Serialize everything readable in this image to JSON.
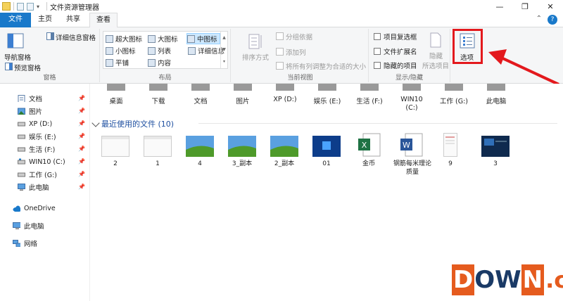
{
  "window": {
    "title": "文件资源管理器",
    "minimize": "—",
    "maximize": "❐",
    "close": "✕"
  },
  "tabs": {
    "file": "文件",
    "home": "主页",
    "share": "共享",
    "view": "查看"
  },
  "ribbon": {
    "pane": {
      "nav_pane": "导航窗格",
      "preview_pane": "预览窗格",
      "details_pane": "详细信息窗格",
      "label": "窗格"
    },
    "layout": {
      "xlarge": "超大图标",
      "large": "大图标",
      "medium": "中图标",
      "small": "小图标",
      "list": "列表",
      "details": "详细信息",
      "tiles": "平铺",
      "content": "内容",
      "label": "布局"
    },
    "current_view": {
      "sort": "排序方式",
      "group": "分组依据",
      "add_column": "添加列",
      "fit_columns": "将所有列调整为合适的大小",
      "label": "当前视图"
    },
    "show_hide": {
      "item_checkboxes": "项目复选框",
      "file_ext": "文件扩展名",
      "hidden_items": "隐藏的项目",
      "hide": "隐藏",
      "selected_items": "所选项目",
      "label": "显示/隐藏"
    },
    "options": {
      "label": "选项"
    }
  },
  "nav": {
    "items": [
      {
        "label": "文档",
        "pinned": true
      },
      {
        "label": "图片",
        "pinned": true
      },
      {
        "label": "XP (D:)",
        "pinned": true
      },
      {
        "label": "娱乐 (E:)",
        "pinned": true
      },
      {
        "label": "生活 (F:)",
        "pinned": true
      },
      {
        "label": "WIN10 (C:)",
        "pinned": true
      },
      {
        "label": "工作 (G:)",
        "pinned": true
      },
      {
        "label": "此电脑",
        "pinned": true
      },
      {
        "label": "OneDrive",
        "pinned": false
      },
      {
        "label": "此电脑",
        "pinned": false
      },
      {
        "label": "网络",
        "pinned": false
      }
    ],
    "pin_glyph": "📌"
  },
  "frequent": {
    "items": [
      "桌面",
      "下载",
      "文档",
      "图片",
      "XP (D:)",
      "娱乐 (E:)",
      "生活 (F:)",
      "WIN10\n(C:)",
      "工作 (G:)",
      "此电脑"
    ]
  },
  "recent": {
    "header": "最近使用的文件 (10)",
    "items": [
      "2",
      "1",
      "4",
      "3_副本",
      "2_副本",
      "01",
      "金币",
      "钢筋每米理论质量",
      "9",
      "3"
    ]
  },
  "watermark": {
    "d": "D",
    "ow": "OW",
    "n": "N",
    "cc": ".cc"
  },
  "colors": {
    "accent": "#1979ca",
    "highlight": "#e3191d",
    "selected": "#cce8ff"
  }
}
